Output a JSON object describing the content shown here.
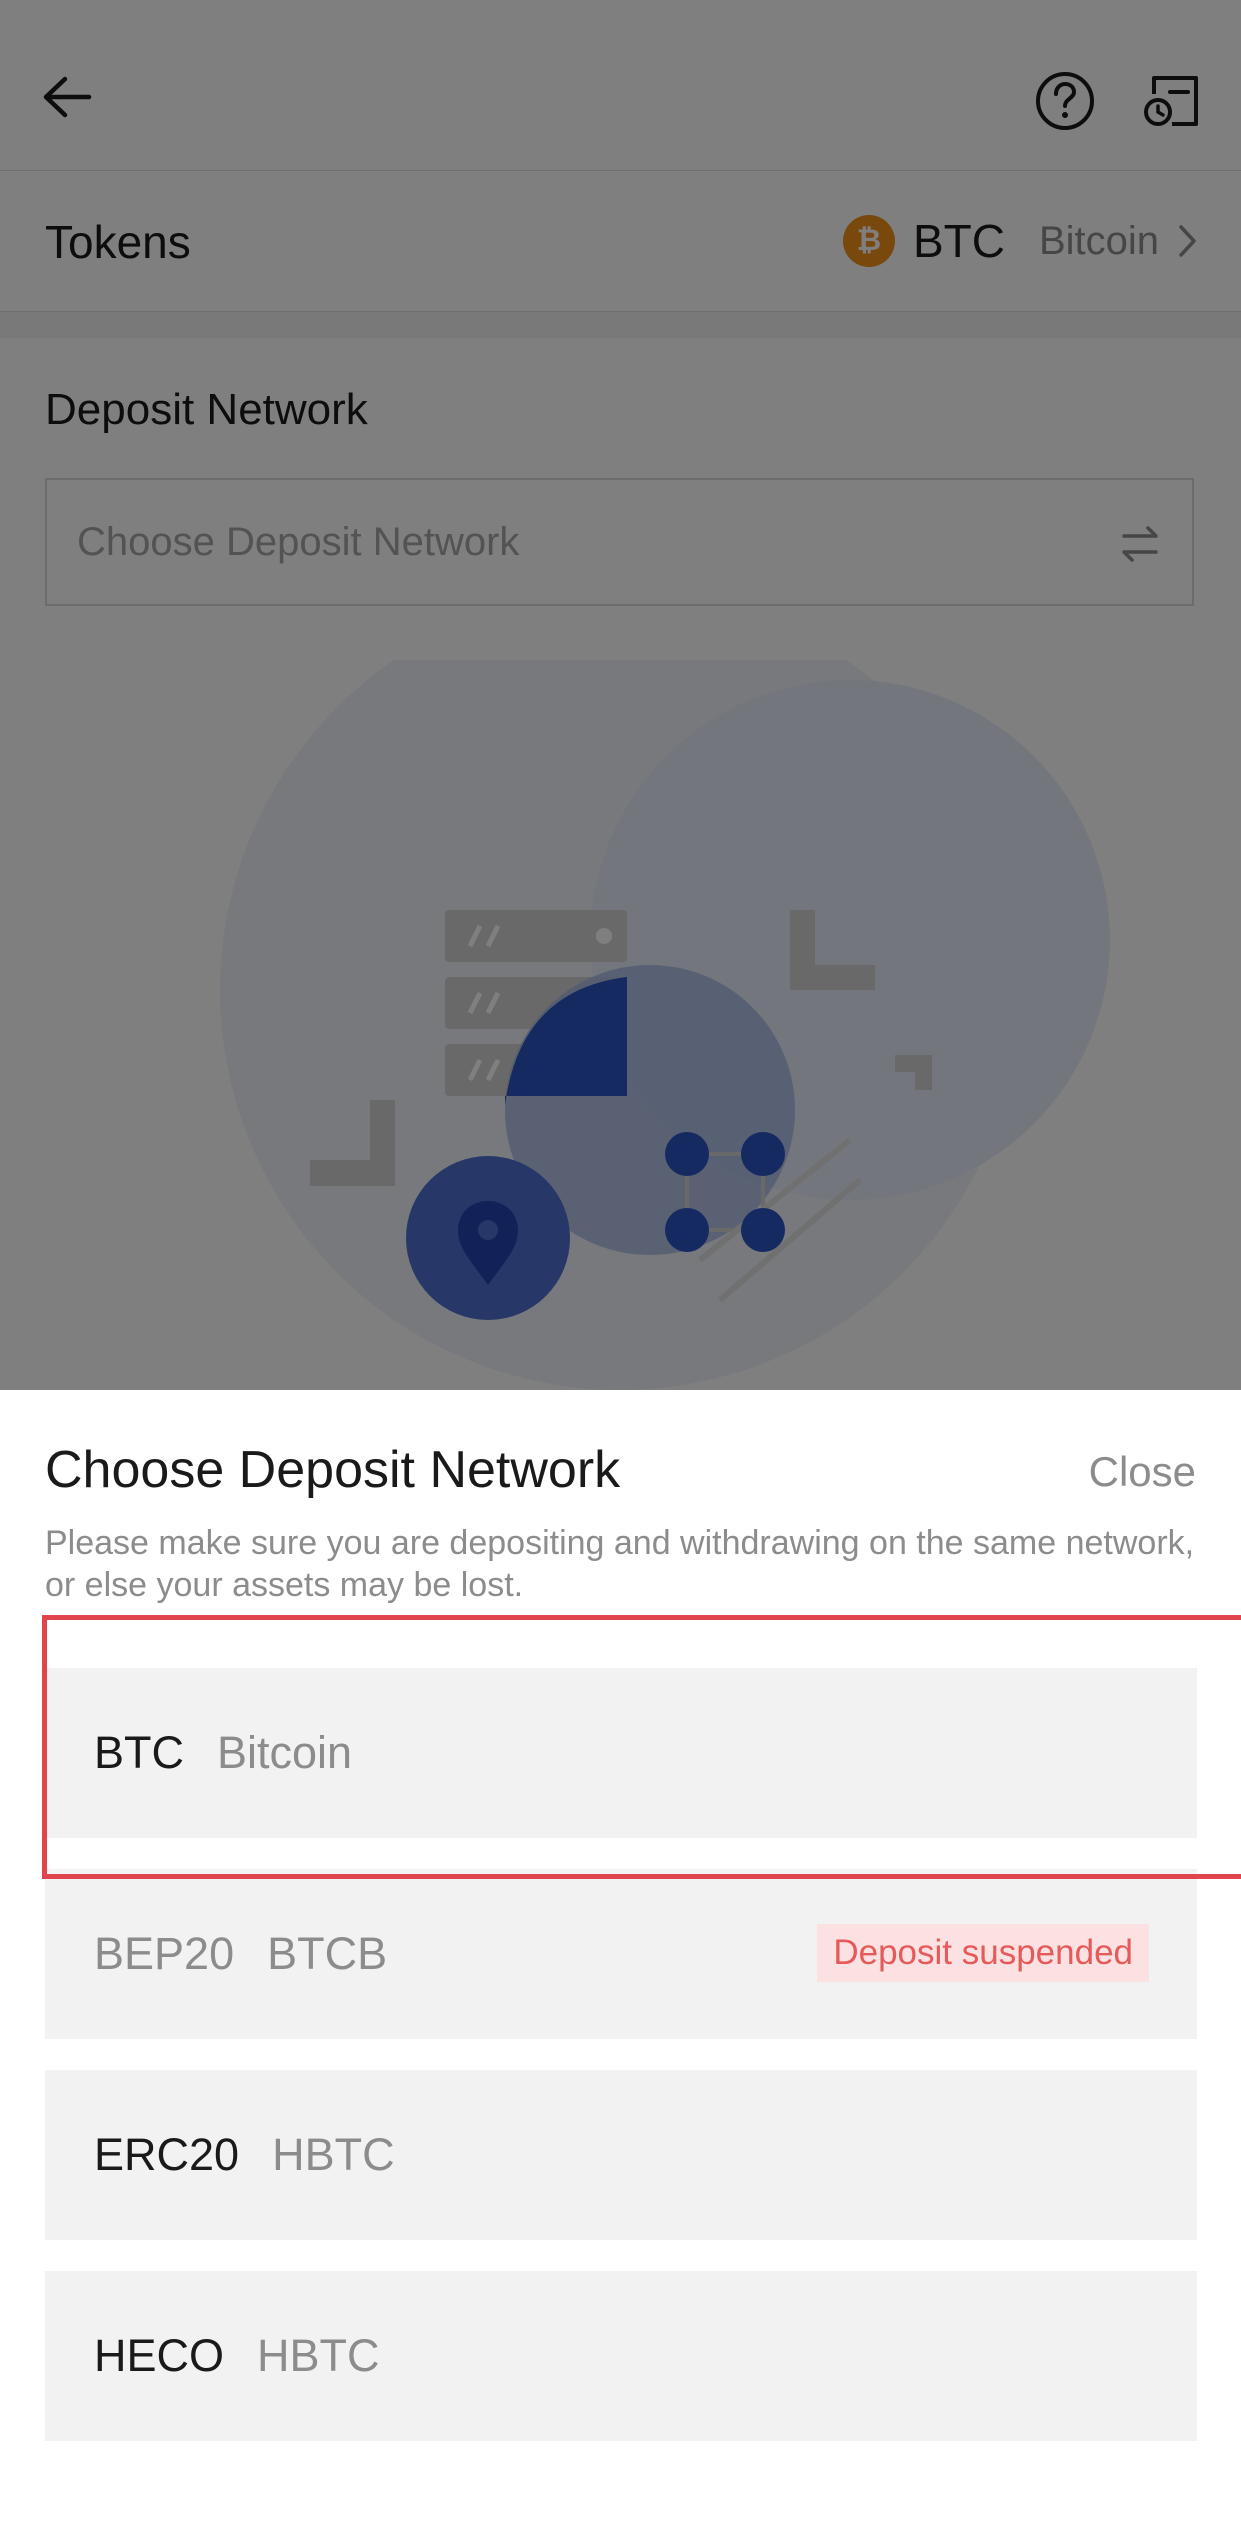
{
  "header": {
    "back_icon": "arrow-left-icon",
    "help_icon": "question-circle-icon",
    "records_icon": "records-icon"
  },
  "tokens": {
    "label": "Tokens",
    "symbol": "BTC",
    "name": "Bitcoin",
    "coin_color": "#f0901a"
  },
  "deposit": {
    "title": "Deposit Network",
    "placeholder": "Choose Deposit Network"
  },
  "sheet": {
    "title": "Choose Deposit Network",
    "close_label": "Close",
    "notice": "Please make sure you are depositing and withdrawing on the same network, or else your assets may be lost.",
    "options": [
      {
        "network": "BTC",
        "token": "Bitcoin",
        "badge": ""
      },
      {
        "network": "BEP20",
        "token": "BTCB",
        "badge": "Deposit suspended"
      },
      {
        "network": "ERC20",
        "token": "HBTC",
        "badge": ""
      },
      {
        "network": "HECO",
        "token": "HBTC",
        "badge": ""
      }
    ]
  },
  "colors": {
    "highlight_border": "#e0454e",
    "suspended_text": "#e65a5a",
    "suspended_bg": "#fbe1e1"
  }
}
